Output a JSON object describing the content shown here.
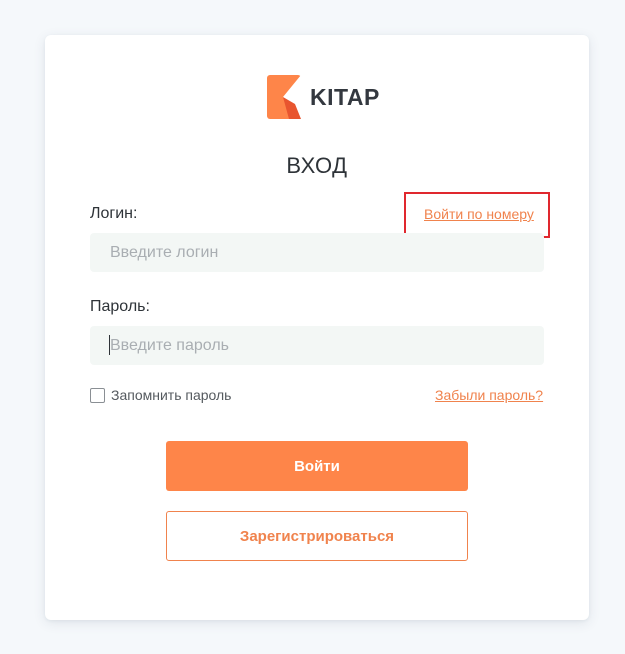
{
  "brand": {
    "name": "KITAP",
    "logo_icon": "kitap-logo-icon",
    "accent_color": "#fe8549",
    "accent_dark": "#e8552f"
  },
  "form": {
    "title": "ВХОД",
    "login_label": "Логин:",
    "login_by_phone_link": "Войти по номеру",
    "login_placeholder": "Введите логин",
    "login_value": "",
    "password_label": "Пароль:",
    "password_placeholder": "Введите пароль",
    "password_value": "",
    "remember_label": "Запомнить пароль",
    "remember_checked": false,
    "forgot_link": "Забыли пароль?",
    "submit_button": "Войти",
    "register_button": "Зарегистрироваться"
  },
  "annotation": {
    "highlight_color": "#e0282e"
  }
}
